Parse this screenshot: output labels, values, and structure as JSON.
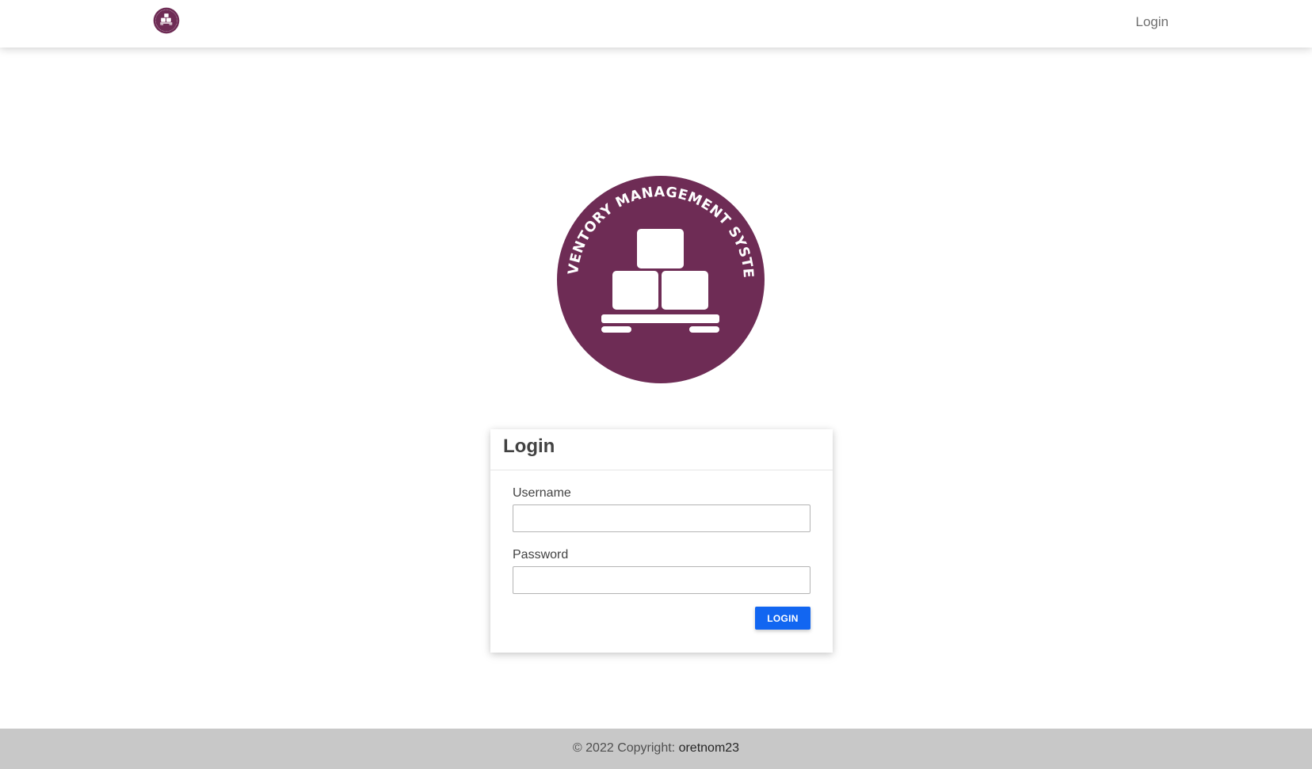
{
  "navbar": {
    "logo_icon": "inventory-logo-icon",
    "login_link": "Login"
  },
  "logo": {
    "circle_text": "INVENTORY MANAGEMENT SYSTEM",
    "icon": "boxes-on-pallet-icon",
    "color": "#6e2c55"
  },
  "login_card": {
    "title": "Login",
    "username_label": "Username",
    "username_value": "",
    "password_label": "Password",
    "password_value": "",
    "submit_label": "LOGIN",
    "button_color": "#1266f1"
  },
  "footer": {
    "copyright_prefix": "© 2022 Copyright:",
    "author": "oretnom23"
  }
}
